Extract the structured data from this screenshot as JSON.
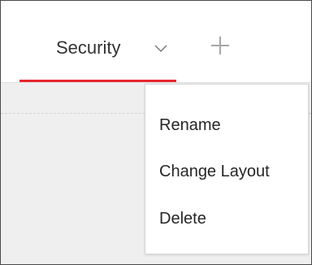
{
  "tabs": [
    {
      "label": "Security",
      "active": true,
      "icon": "chevron-down-icon"
    }
  ],
  "add_tab_icon": "plus-icon",
  "context_menu": {
    "items": [
      {
        "label": "Rename"
      },
      {
        "label": "Change Layout"
      },
      {
        "label": "Delete"
      }
    ]
  },
  "colors": {
    "active_tab_underline": "#e8262e",
    "icon_gray": "#9a9a9a",
    "background": "#efefef"
  }
}
